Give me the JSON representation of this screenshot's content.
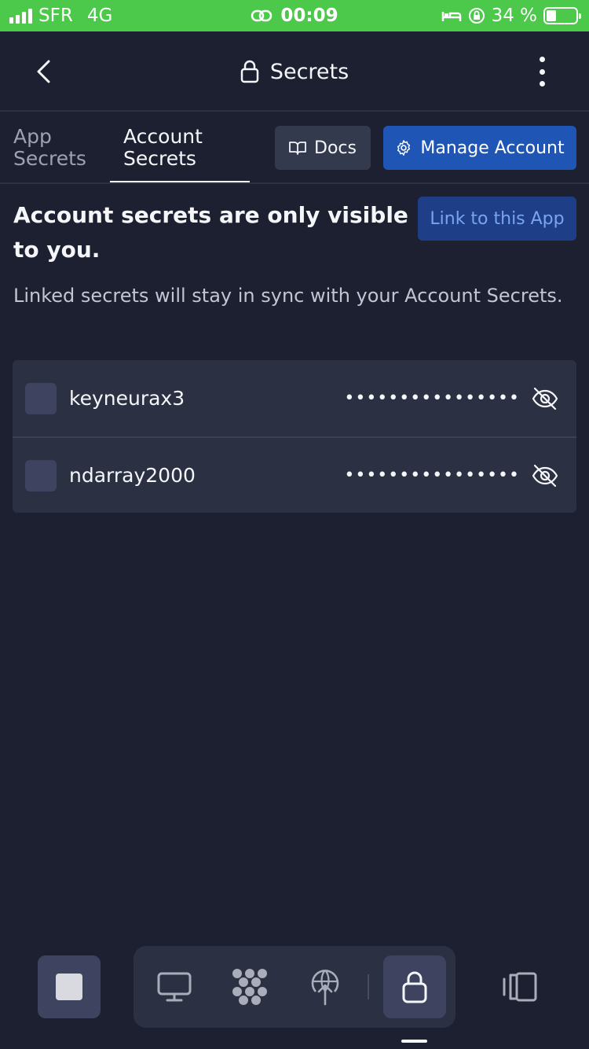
{
  "status_bar": {
    "carrier": "SFR",
    "network": "4G",
    "time": "00:09",
    "battery_percent": "34 %",
    "battery_level": 0.34,
    "icons": [
      "signal-icon",
      "link-icon",
      "bed-icon",
      "rotation-lock-icon",
      "battery-icon"
    ],
    "bg_color": "#4cc94a"
  },
  "header": {
    "title": "Secrets",
    "title_icon": "lock-icon",
    "back_icon": "chevron-left-icon",
    "menu_icon": "more-vertical-icon"
  },
  "tabs": {
    "items": [
      {
        "label_line1": "App",
        "label_line2": "Secrets",
        "active": false
      },
      {
        "label_line1": "Account",
        "label_line2": "Secrets",
        "active": true
      }
    ]
  },
  "actions": {
    "docs_label": "Docs",
    "docs_icon": "book-icon",
    "manage_label": "Manage Account",
    "manage_icon": "gear-icon",
    "link_label": "Link to this App"
  },
  "intro": {
    "heading": "Account secrets are only visible to you.",
    "description": "Linked secrets will stay in sync with your Account Secrets."
  },
  "secrets": [
    {
      "name": "keyneurax3",
      "value": "••••••••••••••••",
      "checked": false
    },
    {
      "name": "ndarray2000",
      "value": "••••••••••••••••",
      "checked": false
    }
  ],
  "bottom_bar": {
    "tools": [
      "monitor-icon",
      "packager-icon",
      "deployments-icon",
      "lock-icon"
    ],
    "active_tool": "lock-icon",
    "left_icon": "stop-icon",
    "right_icon": "panels-icon"
  },
  "colors": {
    "background": "#1c2031",
    "surface": "#2b3043",
    "primary": "#1f56b5",
    "link_button": "#1e3f87",
    "link_text": "#7aa3f0"
  }
}
